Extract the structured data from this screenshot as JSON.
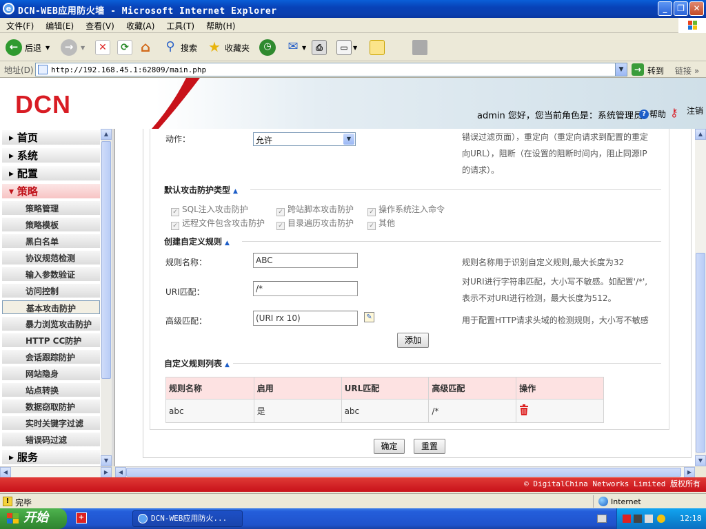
{
  "window": {
    "title": "DCN-WEB应用防火墙 - Microsoft Internet Explorer"
  },
  "menu": [
    "文件(F)",
    "编辑(E)",
    "查看(V)",
    "收藏(A)",
    "工具(T)",
    "帮助(H)"
  ],
  "toolbar": {
    "back": "后退",
    "search": "搜索",
    "favorites": "收藏夹"
  },
  "address": {
    "label": "地址(D)",
    "url": "http://192.168.45.1:62809/main.php",
    "go": "转到",
    "links": "链接"
  },
  "header": {
    "logo": "DCN",
    "user_line": "admin 您好，您当前角色是：系统管理员。",
    "help": "帮助",
    "logout": "注销"
  },
  "sidebar": {
    "top": [
      {
        "label": "首页",
        "expanded": false
      },
      {
        "label": "系统",
        "expanded": false
      },
      {
        "label": "配置",
        "expanded": false
      },
      {
        "label": "策略",
        "expanded": true
      },
      {
        "label": "服务",
        "expanded": false
      }
    ],
    "sub": [
      "策略管理",
      "策略模板",
      "黑白名单",
      "协议规范检测",
      "输入参数验证",
      "访问控制",
      "基本攻击防护",
      "暴力浏览攻击防护",
      "HTTP CC防护",
      "会话跟踪防护",
      "网站隐身",
      "站点转换",
      "数据窃取防护",
      "实时关键字过滤",
      "错误码过滤"
    ],
    "selected": "基本攻击防护"
  },
  "form": {
    "action_label": "动作：",
    "action_value": "允许",
    "action_hint_1": "错误过滤页面），重定向（重定向请求到配置的重定",
    "action_hint_2": "向URL），阻断（在设置的阻断时间内，阻止同源IP",
    "action_hint_3": "的请求）。",
    "default_section": "默认攻击防护类型",
    "checkboxes": [
      "SQL注入攻击防护",
      "跨站脚本攻击防护",
      "操作系统注入命令",
      "远程文件包含攻击防护",
      "目录遍历攻击防护",
      "其他"
    ],
    "custom_section": "创建自定义规则",
    "rule_name_label": "规则名称：",
    "rule_name_value": "ABC",
    "rule_name_hint": "规则名称用于识别自定义规则,最大长度为32",
    "uri_label": "URI匹配：",
    "uri_value": "/*",
    "uri_hint_1": "对URI进行字符串匹配，大小写不敏感。如配置'/*',",
    "uri_hint_2": "表示不对URI进行检测，最大长度为512。",
    "adv_label": "高级匹配：",
    "adv_value": "(URI rx 10)",
    "adv_hint": "用于配置HTTP请求头域的检测规则，大小写不敏感",
    "add_button": "添加",
    "list_section": "自定义规则列表",
    "table_headers": [
      "规则名称",
      "启用",
      "URL匹配",
      "高级匹配",
      "操作"
    ],
    "table_rows": [
      [
        "abc",
        "是",
        "abc",
        "/*"
      ]
    ],
    "ok_button": "确定",
    "reset_button": "重置"
  },
  "footer": {
    "copyright": "© DigitalChina Networks Limited 版权所有"
  },
  "status": {
    "text": "完毕",
    "zone": "Internet"
  },
  "taskbar": {
    "start": "开始",
    "task": "DCN-WEB应用防火...",
    "clock": "12:18"
  },
  "colors": {
    "brand_red": "#c8121a",
    "header_row": "#fde2e2",
    "link_blue": "#1d5ec8"
  }
}
